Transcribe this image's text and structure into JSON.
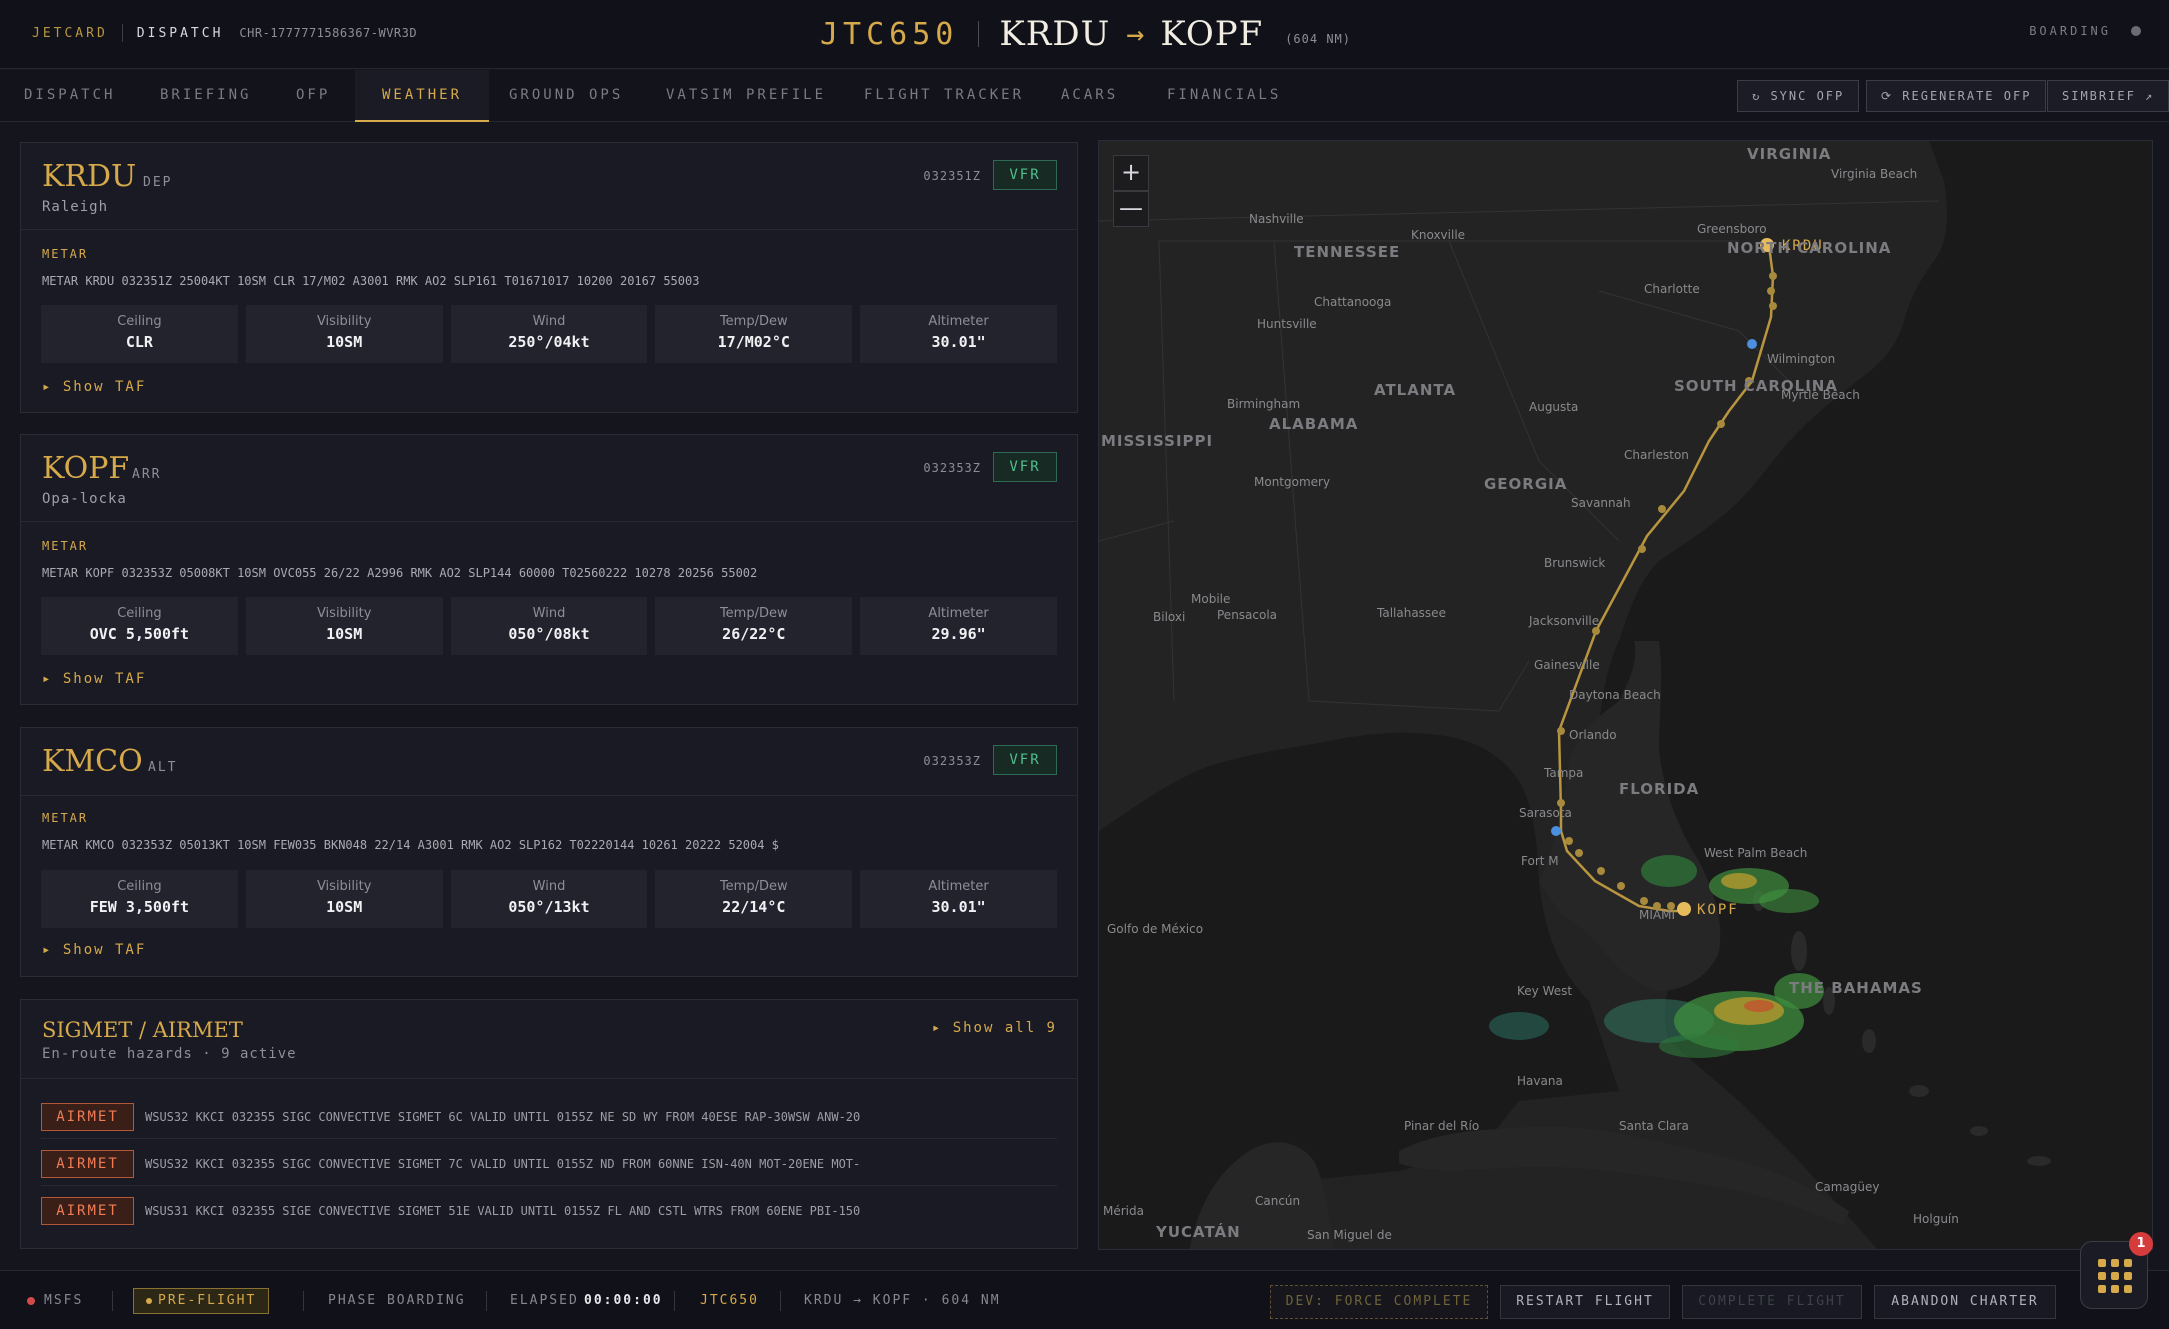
{
  "topbar": {
    "brand": "JETCARD",
    "section": "DISPATCH",
    "charter_id": "CHR-1777771586367-WVR3D",
    "callsign": "JTC650",
    "origin": "KRDU",
    "arrow": "→",
    "destination": "KOPF",
    "distance": "(604 NM)",
    "status": "BOARDING"
  },
  "tabs": [
    {
      "label": "DISPATCH"
    },
    {
      "label": "BRIEFING"
    },
    {
      "label": "OFP"
    },
    {
      "label": "WEATHER"
    },
    {
      "label": "GROUND OPS"
    },
    {
      "label": "VATSIM PREFILE"
    },
    {
      "label": "FLIGHT TRACKER"
    },
    {
      "label": "ACARS"
    },
    {
      "label": "FINANCIALS"
    }
  ],
  "active_tab": "WEATHER",
  "toolbar": {
    "sync_ofp": "SYNC OFP",
    "regenerate_ofp": "REGENERATE OFP",
    "simbrief": "SIMBRIEF ↗"
  },
  "labels": {
    "metar": "METAR",
    "ceiling": "Ceiling",
    "visibility": "Visibility",
    "wind": "Wind",
    "tempdew": "Temp/Dew",
    "altimeter": "Altimeter",
    "show_taf": "▸ Show TAF"
  },
  "stations": [
    {
      "icao": "KRDU",
      "role": "DEP",
      "city": "Raleigh",
      "obs_time": "032351Z",
      "category": "VFR",
      "metar": "METAR KRDU 032351Z 25004KT 10SM CLR 17/M02 A3001 RMK AO2 SLP161 T01671017 10200 20167 55003",
      "ceiling": "CLR",
      "visibility": "10SM",
      "wind": "250°/04kt",
      "tempdew": "17/M02°C",
      "altimeter": "30.01\""
    },
    {
      "icao": "KOPF",
      "role": "ARR",
      "city": "Opa-locka",
      "obs_time": "032353Z",
      "category": "VFR",
      "metar": "METAR KOPF 032353Z 05008KT 10SM OVC055 26/22 A2996 RMK AO2 SLP144 60000 T02560222 10278 20256 55002",
      "ceiling": "OVC 5,500ft",
      "visibility": "10SM",
      "wind": "050°/08kt",
      "tempdew": "26/22°C",
      "altimeter": "29.96\""
    },
    {
      "icao": "KMCO",
      "role": "ALT",
      "city": "",
      "obs_time": "032353Z",
      "category": "VFR",
      "metar": "METAR KMCO 032353Z 05013KT 10SM FEW035 BKN048 22/14 A3001 RMK AO2 SLP162 T02220144 10261 20222 52004 $",
      "ceiling": "FEW 3,500ft",
      "visibility": "10SM",
      "wind": "050°/13kt",
      "tempdew": "22/14°C",
      "altimeter": "30.01\""
    }
  ],
  "sigmet": {
    "title": "SIGMET / AIRMET",
    "subtitle": "En-route hazards · 9 active",
    "show_all": "▸ Show all 9",
    "items": [
      {
        "type": "AIRMET",
        "text": "WSUS32 KKCI 032355 SIGC CONVECTIVE SIGMET 6C VALID UNTIL 0155Z NE SD WY FROM 40ESE RAP-30WSW ANW-20"
      },
      {
        "type": "AIRMET",
        "text": "WSUS32 KKCI 032355 SIGC CONVECTIVE SIGMET 7C VALID UNTIL 0155Z ND FROM 60NNE ISN-40N MOT-20ENE MOT-"
      },
      {
        "type": "AIRMET",
        "text": "WSUS31 KKCI 032355 SIGE CONVECTIVE SIGMET 51E VALID UNTIL 0155Z FL AND CSTL WTRS FROM 60ENE PBI-150"
      }
    ]
  },
  "map": {
    "zoom_in": "+",
    "zoom_out": "—",
    "origin_label": "KRDU",
    "dest_label": "KOPF",
    "places": [
      {
        "name": "VIRGINIA",
        "cls": "big"
      },
      {
        "name": "Virginia Beach"
      },
      {
        "name": "Greensboro"
      },
      {
        "name": "NORTH CAROLINA",
        "cls": "big"
      },
      {
        "name": "Nashville"
      },
      {
        "name": "Knoxville"
      },
      {
        "name": "TENNESSEE",
        "cls": "big"
      },
      {
        "name": "Charlotte"
      },
      {
        "name": "Chattanooga"
      },
      {
        "name": "Huntsville"
      },
      {
        "name": "Wilmington"
      },
      {
        "name": "SOUTH CAROLINA",
        "cls": "big"
      },
      {
        "name": "Myrtle Beach"
      },
      {
        "name": "ATLANTA",
        "cls": "big"
      },
      {
        "name": "Augusta"
      },
      {
        "name": "Birmingham"
      },
      {
        "name": "ALABAMA",
        "cls": "big"
      },
      {
        "name": "MISSISSIPPI",
        "cls": "big"
      },
      {
        "name": "Charleston"
      },
      {
        "name": "Montgomery"
      },
      {
        "name": "GEORGIA",
        "cls": "big"
      },
      {
        "name": "Savannah"
      },
      {
        "name": "Brunswick"
      },
      {
        "name": "Mobile"
      },
      {
        "name": "Biloxi"
      },
      {
        "name": "Pensacola"
      },
      {
        "name": "Tallahassee"
      },
      {
        "name": "Jacksonville"
      },
      {
        "name": "Gainesville"
      },
      {
        "name": "Daytona Beach"
      },
      {
        "name": "Orlando"
      },
      {
        "name": "Tampa"
      },
      {
        "name": "FLORIDA",
        "cls": "big"
      },
      {
        "name": "Sarasota"
      },
      {
        "name": "Fort M"
      },
      {
        "name": "West Palm Beach"
      },
      {
        "name": "MIAMI"
      },
      {
        "name": "Golfo de México"
      },
      {
        "name": "THE BAHAMAS",
        "cls": "big"
      },
      {
        "name": "Key West"
      },
      {
        "name": "Havana"
      },
      {
        "name": "Pinar del Río"
      },
      {
        "name": "Santa Clara"
      },
      {
        "name": "Camagüey"
      },
      {
        "name": "Holguín"
      },
      {
        "name": "Cancún"
      },
      {
        "name": "Mérida"
      },
      {
        "name": "YUCATÁN",
        "cls": "big"
      },
      {
        "name": "San Miguel de"
      }
    ]
  },
  "bottombar": {
    "sim": "MSFS",
    "phase_pill": "PRE-FLIGHT",
    "phase": "PHASE BOARDING",
    "elapsed_label": "ELAPSED",
    "elapsed": "00:00:00",
    "callsign": "JTC650",
    "route": "KRDU → KOPF · 604 NM",
    "dev_force": "DEV: FORCE COMPLETE",
    "restart": "RESTART FLIGHT",
    "complete": "COMPLETE FLIGHT",
    "abandon": "ABANDON CHARTER"
  },
  "fab": {
    "count": "1"
  },
  "colors": {
    "accent": "#d6a94a",
    "vfr": "#4fbf8e",
    "airmet": "#f07c55",
    "background": "#14151d"
  }
}
